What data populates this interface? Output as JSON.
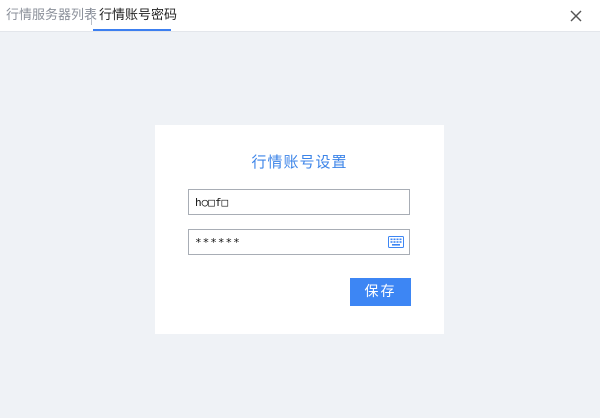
{
  "tabs": [
    {
      "label": "行情服务器列表",
      "active": false
    },
    {
      "label": "行情账号密码",
      "active": true
    }
  ],
  "form": {
    "title": "行情账号设置",
    "username_value": "h○□f□",
    "password_value": "******",
    "save_label": "保存"
  },
  "icons": {
    "close": "close-icon",
    "keyboard": "keyboard-icon"
  },
  "colors": {
    "accent": "#3c7ff0",
    "title": "#3c84e8",
    "button": "#3d86f4",
    "background": "#eff2f6"
  }
}
